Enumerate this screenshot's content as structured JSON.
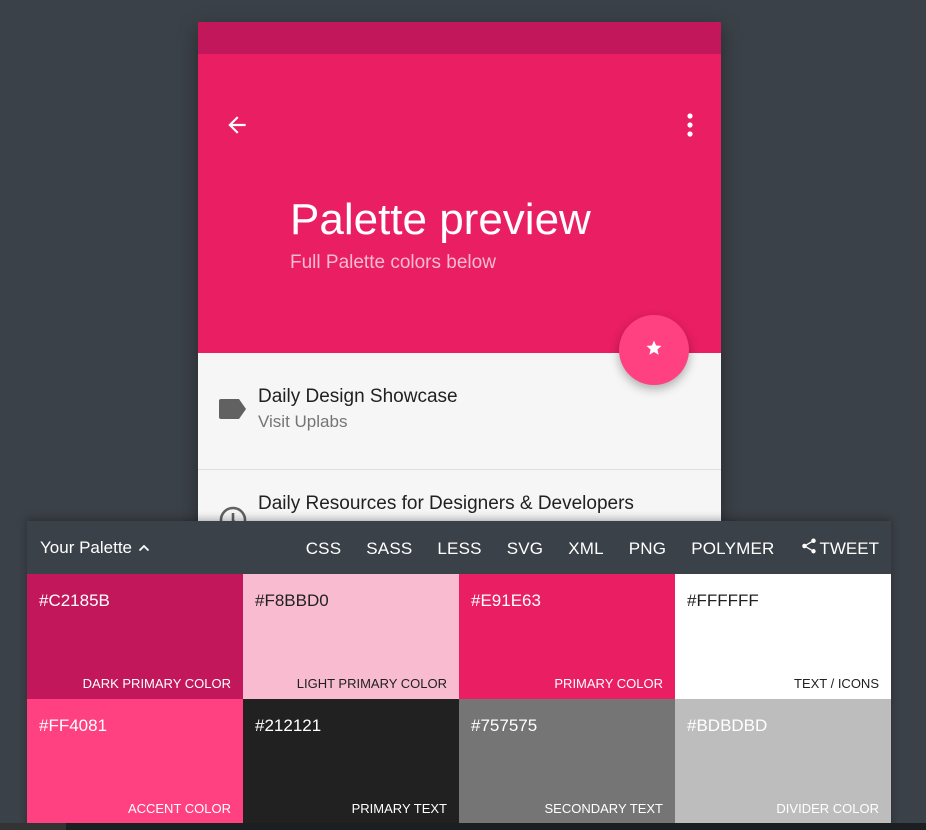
{
  "preview": {
    "title": "Palette preview",
    "subtitle": "Full Palette colors below",
    "list": [
      {
        "primary": "Daily Design Showcase",
        "secondary": "Visit Uplabs",
        "icon": "label-icon"
      },
      {
        "primary": "Daily Resources for Designers & Developers",
        "secondary": "",
        "icon": "clock-icon"
      }
    ]
  },
  "palette_bar": {
    "label": "Your Palette",
    "formats": [
      "CSS",
      "SASS",
      "LESS",
      "SVG",
      "XML",
      "PNG",
      "POLYMER"
    ],
    "tweet": "TWEET"
  },
  "swatches": [
    {
      "hex": "#C2185B",
      "name": "DARK PRIMARY COLOR",
      "bg": "#C2185B",
      "fg": "#ffffff"
    },
    {
      "hex": "#F8BBD0",
      "name": "LIGHT PRIMARY COLOR",
      "bg": "#F8BBD0",
      "fg": "#212121"
    },
    {
      "hex": "#E91E63",
      "name": "PRIMARY COLOR",
      "bg": "#E91E63",
      "fg": "#ffffff"
    },
    {
      "hex": "#FFFFFF",
      "name": "TEXT / ICONS",
      "bg": "#FFFFFF",
      "fg": "#212121"
    },
    {
      "hex": "#FF4081",
      "name": "ACCENT COLOR",
      "bg": "#FF4081",
      "fg": "#ffffff"
    },
    {
      "hex": "#212121",
      "name": "PRIMARY TEXT",
      "bg": "#212121",
      "fg": "#ffffff"
    },
    {
      "hex": "#757575",
      "name": "SECONDARY TEXT",
      "bg": "#757575",
      "fg": "#ffffff"
    },
    {
      "hex": "#BDBDBD",
      "name": "DIVIDER COLOR",
      "bg": "#BDBDBD",
      "fg": "#ffffff"
    }
  ]
}
